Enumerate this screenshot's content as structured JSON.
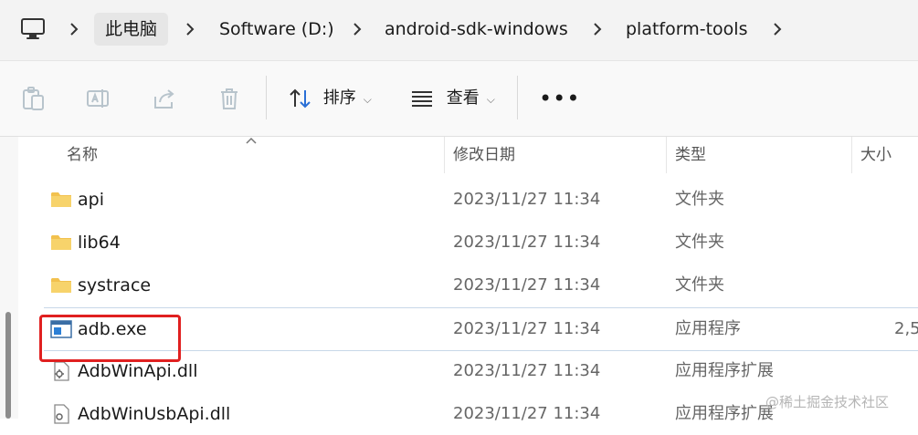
{
  "address": {
    "crumbs": [
      "此电脑",
      "Software (D:)",
      "android-sdk-windows",
      "platform-tools"
    ]
  },
  "toolbar": {
    "sort_label": "排序",
    "view_label": "查看",
    "more_label": "•••"
  },
  "columns": {
    "name": "名称",
    "date": "修改日期",
    "type": "类型",
    "size": "大小"
  },
  "rows": [
    {
      "name": "api",
      "date": "2023/11/27 11:34",
      "type": "文件夹",
      "size": "",
      "icon": "folder-icon"
    },
    {
      "name": "lib64",
      "date": "2023/11/27 11:34",
      "type": "文件夹",
      "size": "",
      "icon": "folder-icon"
    },
    {
      "name": "systrace",
      "date": "2023/11/27 11:34",
      "type": "文件夹",
      "size": "",
      "icon": "folder-icon"
    },
    {
      "name": "adb.exe",
      "date": "2023/11/27 11:34",
      "type": "应用程序",
      "size": "2,5",
      "icon": "exe-icon"
    },
    {
      "name": "AdbWinApi.dll",
      "date": "2023/11/27 11:34",
      "type": "应用程序扩展",
      "size": "",
      "icon": "dll-icon"
    },
    {
      "name": "AdbWinUsbApi.dll",
      "date": "2023/11/27 11:34",
      "type": "应用程序扩展",
      "size": "",
      "icon": "dll-icon"
    }
  ],
  "watermark": "@稀土掘金技术社区",
  "colors": {
    "highlight": "#e02020",
    "folder": "#f2c14e"
  }
}
